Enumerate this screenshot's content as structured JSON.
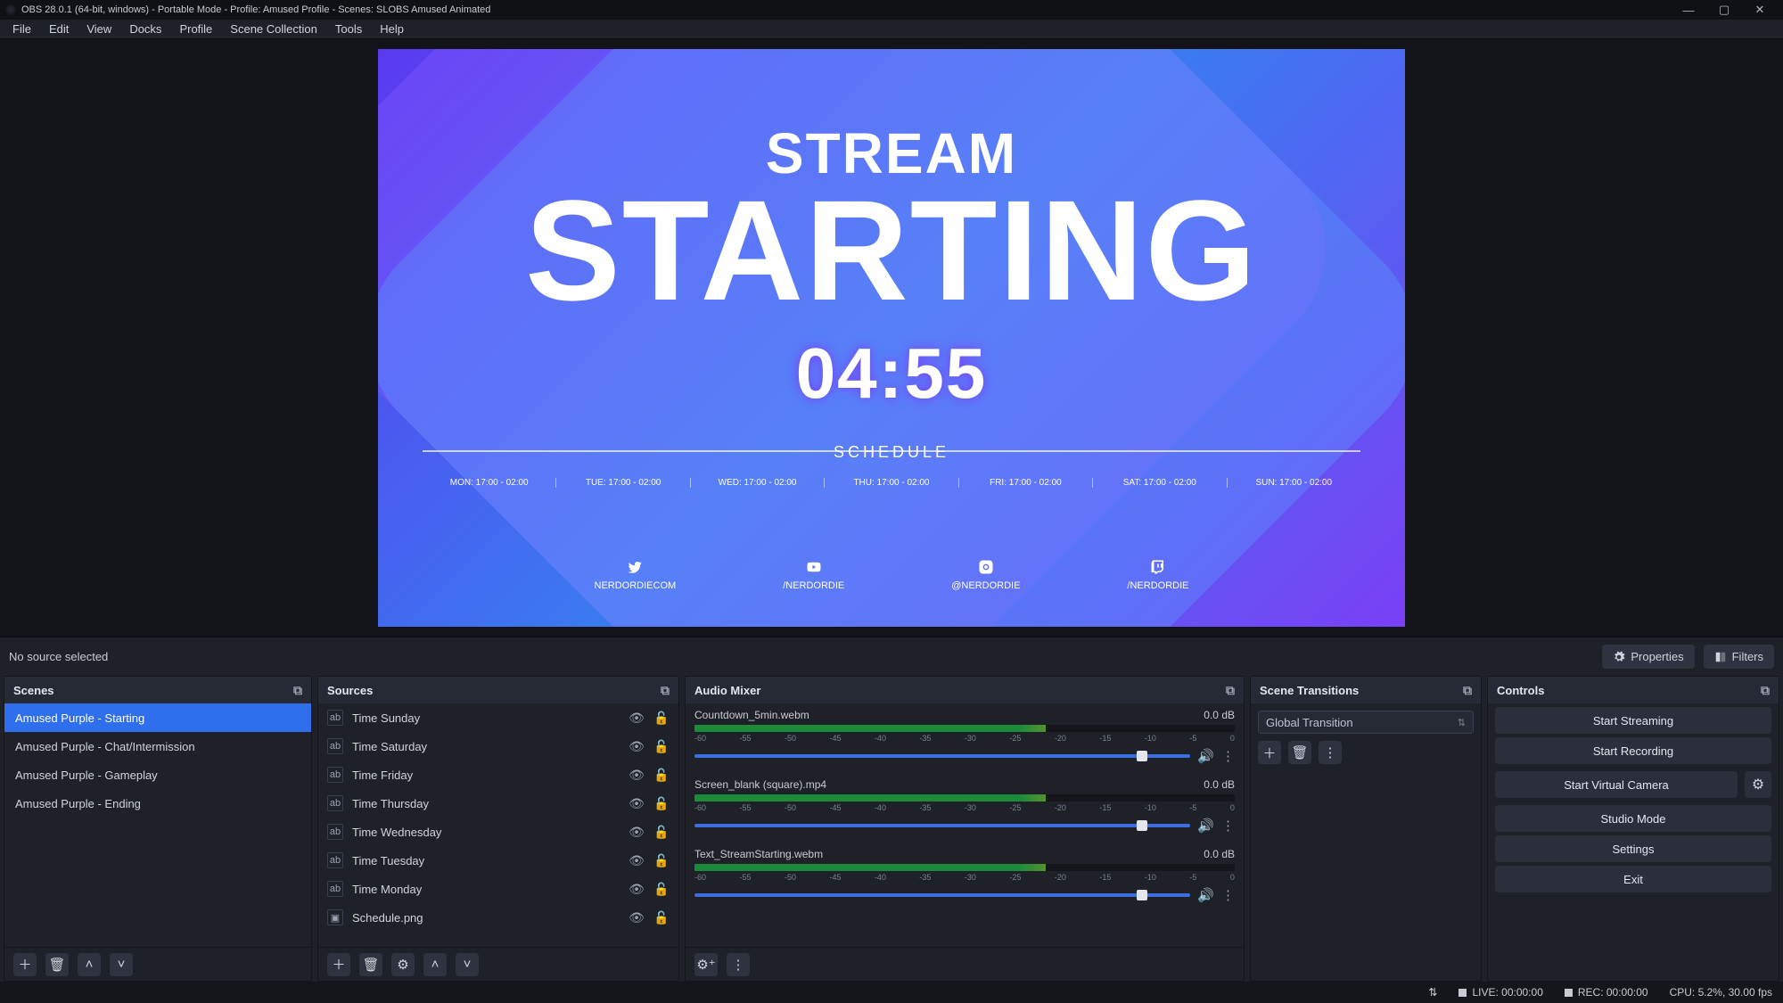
{
  "title": "OBS 28.0.1 (64-bit, windows) - Portable Mode - Profile: Amused Profile - Scenes: SLOBS Amused Animated",
  "menubar": [
    "File",
    "Edit",
    "View",
    "Docks",
    "Profile",
    "Scene Collection",
    "Tools",
    "Help"
  ],
  "preview": {
    "line1": "STREAM",
    "line2": "STARTING",
    "timer": "04:55",
    "schedule_label": "SCHEDULE",
    "days": [
      "MON: 17:00 - 02:00",
      "TUE: 17:00 - 02:00",
      "WED: 17:00 - 02:00",
      "THU: 17:00 - 02:00",
      "FRI: 17:00 - 02:00",
      "SAT: 17:00 - 02:00",
      "SUN: 17:00 - 02:00"
    ],
    "socials": [
      {
        "icon": "twitter",
        "label": "NERDORDIECOM"
      },
      {
        "icon": "youtube",
        "label": "/NERDORDIE"
      },
      {
        "icon": "instagram",
        "label": "@NERDORDIE"
      },
      {
        "icon": "twitch",
        "label": "/NERDORDIE"
      }
    ]
  },
  "context": {
    "no_source": "No source selected",
    "properties": "Properties",
    "filters": "Filters"
  },
  "panels": {
    "scenes": {
      "title": "Scenes",
      "items": [
        "Amused Purple - Starting",
        "Amused Purple - Chat/Intermission",
        "Amused Purple - Gameplay",
        "Amused Purple - Ending"
      ],
      "selected": 0
    },
    "sources": {
      "title": "Sources",
      "items": [
        {
          "type": "ab",
          "name": "Time Sunday"
        },
        {
          "type": "ab",
          "name": "Time Saturday"
        },
        {
          "type": "ab",
          "name": "Time Friday"
        },
        {
          "type": "ab",
          "name": "Time Thursday"
        },
        {
          "type": "ab",
          "name": "Time Wednesday"
        },
        {
          "type": "ab",
          "name": "Time Tuesday"
        },
        {
          "type": "ab",
          "name": "Time Monday"
        },
        {
          "type": "img",
          "name": "Schedule.png"
        }
      ]
    },
    "mixer": {
      "title": "Audio Mixer",
      "ticks": [
        "-60",
        "-55",
        "-50",
        "-45",
        "-40",
        "-35",
        "-30",
        "-25",
        "-20",
        "-15",
        "-10",
        "-5",
        "0"
      ],
      "items": [
        {
          "name": "Countdown_5min.webm",
          "db": "0.0 dB"
        },
        {
          "name": "Screen_blank (square).mp4",
          "db": "0.0 dB"
        },
        {
          "name": "Text_StreamStarting.webm",
          "db": "0.0 dB"
        }
      ]
    },
    "transitions": {
      "title": "Scene Transitions",
      "selected": "Global Transition"
    },
    "controls": {
      "title": "Controls",
      "buttons": [
        "Start Streaming",
        "Start Recording",
        "Start Virtual Camera",
        "Studio Mode",
        "Settings",
        "Exit"
      ]
    }
  },
  "status": {
    "live": "LIVE: 00:00:00",
    "rec": "REC: 00:00:00",
    "cpu": "CPU: 5.2%, 30.00 fps"
  }
}
